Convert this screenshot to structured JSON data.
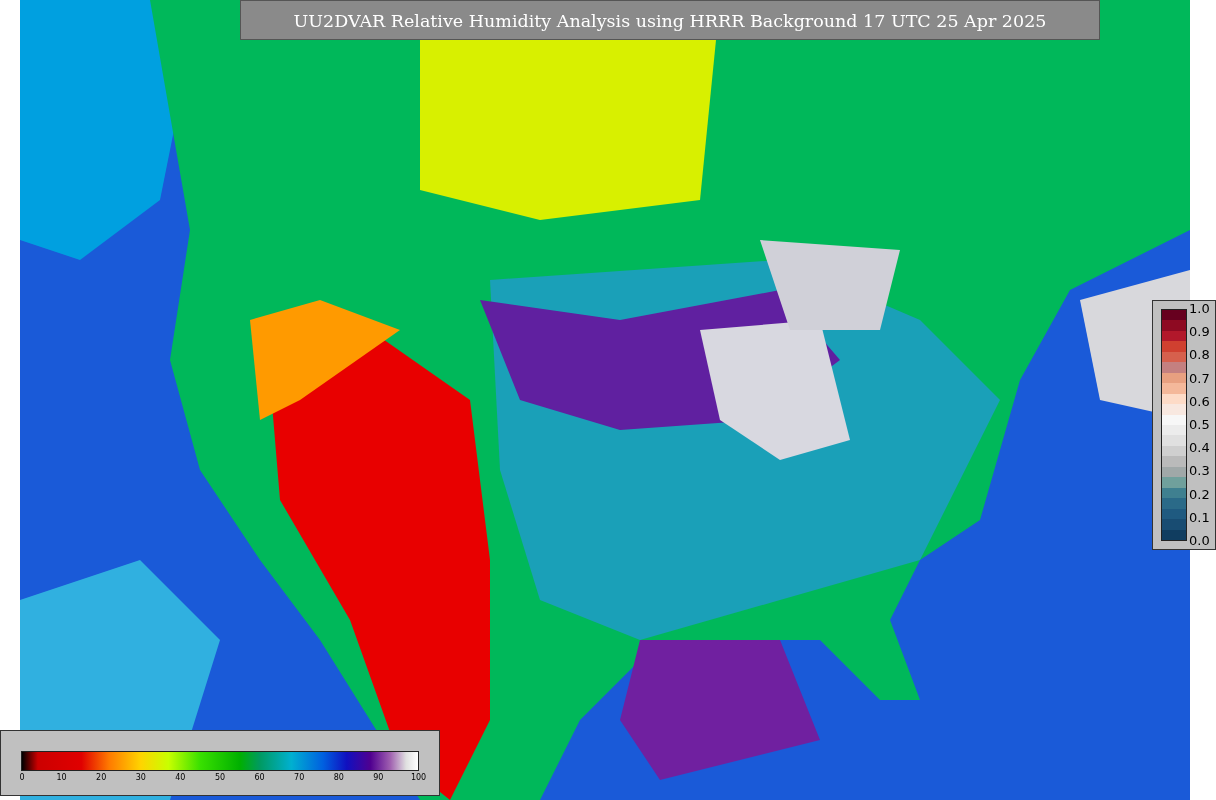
{
  "title": "UU2DVAR Relative Humidity Analysis using HRRR Background 17 UTC 25 Apr 2025",
  "ratio_colorbar": {
    "labels": [
      "1.0",
      "0.9",
      "0.8",
      "0.7",
      "0.6",
      "0.5",
      "0.4",
      "0.3",
      "0.2",
      "0.1",
      "0.0"
    ]
  },
  "humidity_colorbar": {
    "labels": [
      "0",
      "10",
      "20",
      "30",
      "40",
      "50",
      "60",
      "70",
      "80",
      "90",
      "100"
    ]
  }
}
